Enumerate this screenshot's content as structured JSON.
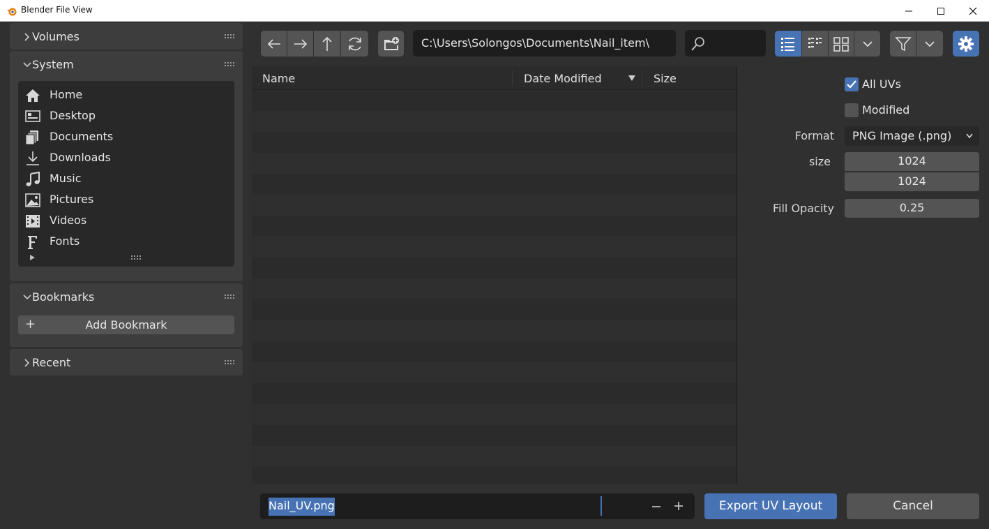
{
  "window": {
    "title": "Blender File View"
  },
  "sidebar": {
    "volumes_label": "Volumes",
    "system_label": "System",
    "system_items": [
      {
        "label": "Home",
        "icon": "home-icon"
      },
      {
        "label": "Desktop",
        "icon": "desktop-icon"
      },
      {
        "label": "Documents",
        "icon": "documents-icon"
      },
      {
        "label": "Downloads",
        "icon": "downloads-icon"
      },
      {
        "label": "Music",
        "icon": "music-icon"
      },
      {
        "label": "Pictures",
        "icon": "pictures-icon"
      },
      {
        "label": "Videos",
        "icon": "videos-icon"
      },
      {
        "label": "Fonts",
        "icon": "fonts-icon"
      }
    ],
    "bookmarks_label": "Bookmarks",
    "add_bookmark_label": "Add Bookmark",
    "recent_label": "Recent"
  },
  "toolbar": {
    "path": "C:\\Users\\Solongos\\Documents\\Nail_item\\"
  },
  "file_list": {
    "columns": [
      "Name",
      "Date Modified",
      "Size"
    ]
  },
  "options": {
    "all_uvs_label": "All UVs",
    "all_uvs_checked": true,
    "modified_label": "Modified",
    "modified_checked": false,
    "format_label": "Format",
    "format_value": "PNG Image (.png)",
    "size_label": "size",
    "size_x": "1024",
    "size_y": "1024",
    "fill_opacity_label": "Fill Opacity",
    "fill_opacity_value": "0.25"
  },
  "footer": {
    "filename": "Nail_UV.png",
    "export_label": "Export UV Layout",
    "cancel_label": "Cancel"
  },
  "colors": {
    "accent": "#4772b3",
    "panel": "#3d3d3d",
    "background": "#303030"
  }
}
